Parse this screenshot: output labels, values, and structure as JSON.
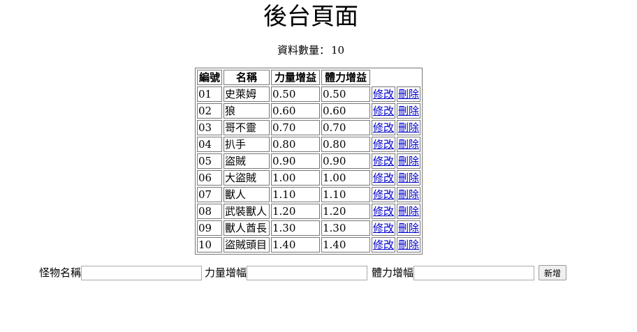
{
  "page": {
    "title": "後台頁面",
    "count_label": "資料數量：",
    "count_value": "10"
  },
  "table": {
    "headers": [
      "編號",
      "名稱",
      "力量增益",
      "體力增益"
    ],
    "edit_label": "修改",
    "delete_label": "刪除",
    "rows": [
      {
        "id": "01",
        "name": "史萊姆",
        "str": "0.50",
        "hp": "0.50"
      },
      {
        "id": "02",
        "name": "狼",
        "str": "0.60",
        "hp": "0.60"
      },
      {
        "id": "03",
        "name": "哥不靈",
        "str": "0.70",
        "hp": "0.70"
      },
      {
        "id": "04",
        "name": "扒手",
        "str": "0.80",
        "hp": "0.80"
      },
      {
        "id": "05",
        "name": "盜賊",
        "str": "0.90",
        "hp": "0.90"
      },
      {
        "id": "06",
        "name": "大盜賊",
        "str": "1.00",
        "hp": "1.00"
      },
      {
        "id": "07",
        "name": "獸人",
        "str": "1.10",
        "hp": "1.10"
      },
      {
        "id": "08",
        "name": "武裝獸人",
        "str": "1.20",
        "hp": "1.20"
      },
      {
        "id": "09",
        "name": "獸人酋長",
        "str": "1.30",
        "hp": "1.30"
      },
      {
        "id": "10",
        "name": "盜賊頭目",
        "str": "1.40",
        "hp": "1.40"
      }
    ]
  },
  "form": {
    "name_label": "怪物名稱",
    "name_value": "",
    "str_label": "力量增幅",
    "str_value": "",
    "hp_label": "體力增幅",
    "hp_value": "",
    "submit_label": "新增"
  }
}
